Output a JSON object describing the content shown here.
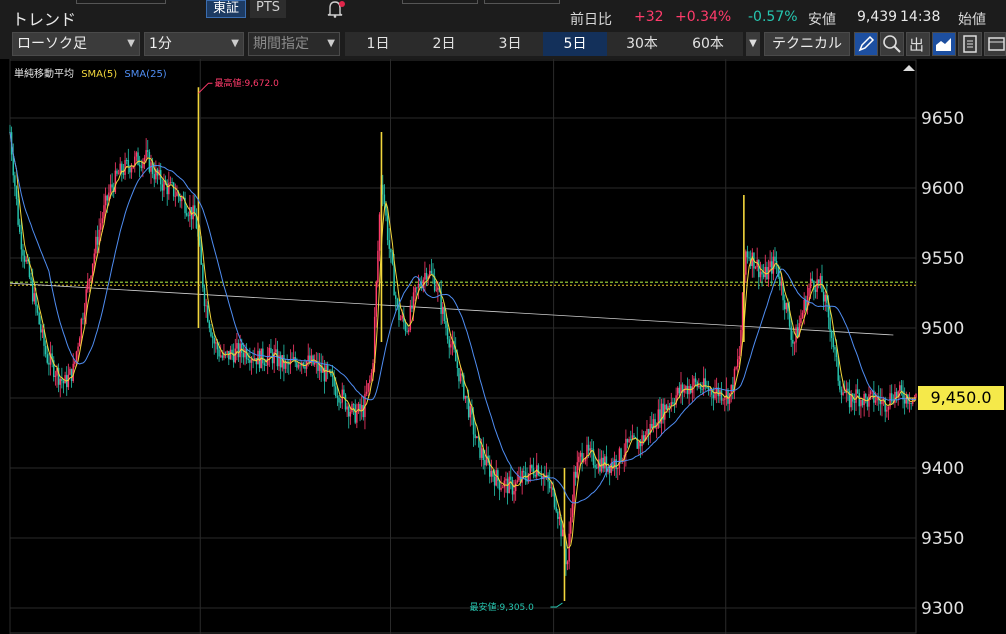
{
  "header": {
    "title": "トレンド",
    "exchange_tabs": [
      {
        "label": "東証",
        "active": true
      },
      {
        "label": "PTS",
        "active": false
      }
    ],
    "bell_icon": "bell-icon",
    "stats": {
      "prev_label": "前日比",
      "change": "+32",
      "change_pct": "+0.34%",
      "low_pct": "-0.57%",
      "low_label": "安値",
      "low_value": "9,439",
      "time": "14:38",
      "open_label": "始値"
    },
    "colors": {
      "up": "#ff3b6b",
      "down": "#26c6b0",
      "accent": "#1d4fa0"
    }
  },
  "toolbar": {
    "chart_type": "ローソク足",
    "interval": "1分",
    "period_label": "期間指定",
    "ranges": [
      {
        "label": "1日",
        "active": false
      },
      {
        "label": "2日",
        "active": false
      },
      {
        "label": "3日",
        "active": false
      },
      {
        "label": "5日",
        "active": true
      },
      {
        "label": "30本",
        "active": false
      },
      {
        "label": "60本",
        "active": false
      }
    ],
    "technical_label": "テクニカル",
    "tool_icons": [
      "pencil-icon",
      "zoom-icon",
      "output-icon",
      "area-chart-icon",
      "note-icon",
      "layout-icon"
    ]
  },
  "chart": {
    "legend": {
      "label": "単純移動平均",
      "sma5": "SMA(5)",
      "sma25": "SMA(25)",
      "sma5_color": "#f2d63c",
      "sma25_color": "#4f8df2"
    },
    "current_price": "9,450.0",
    "high_label": "最高値:9,672.0",
    "low_label": "最安値:9,305.0"
  },
  "chart_data": {
    "type": "candlestick",
    "x_unit": "1-minute bars over 5 trading days",
    "ylim": [
      9290,
      9700
    ],
    "y_ticks": [
      9300,
      9350,
      9400,
      9450,
      9500,
      9550,
      9600,
      9650
    ],
    "current_price": 9450.0,
    "high": 9672.0,
    "low": 9305.0,
    "reference_level": 9532,
    "trendline": {
      "from": [
        0,
        9532
      ],
      "to": [
        0.975,
        9495
      ]
    },
    "day_separators": [
      0.0,
      0.21,
      0.42,
      0.6,
      0.79
    ],
    "price_path": [
      [
        0.0,
        9640
      ],
      [
        0.01,
        9570
      ],
      [
        0.02,
        9540
      ],
      [
        0.03,
        9510
      ],
      [
        0.04,
        9480
      ],
      [
        0.05,
        9470
      ],
      [
        0.06,
        9460
      ],
      [
        0.07,
        9470
      ],
      [
        0.08,
        9510
      ],
      [
        0.09,
        9545
      ],
      [
        0.1,
        9575
      ],
      [
        0.11,
        9598
      ],
      [
        0.12,
        9610
      ],
      [
        0.13,
        9616
      ],
      [
        0.14,
        9620
      ],
      [
        0.15,
        9622
      ],
      [
        0.16,
        9610
      ],
      [
        0.17,
        9602
      ],
      [
        0.18,
        9598
      ],
      [
        0.19,
        9592
      ],
      [
        0.205,
        9578
      ],
      [
        0.215,
        9520
      ],
      [
        0.225,
        9490
      ],
      [
        0.235,
        9478
      ],
      [
        0.245,
        9482
      ],
      [
        0.26,
        9484
      ],
      [
        0.275,
        9478
      ],
      [
        0.29,
        9480
      ],
      [
        0.305,
        9472
      ],
      [
        0.32,
        9478
      ],
      [
        0.335,
        9474
      ],
      [
        0.35,
        9466
      ],
      [
        0.365,
        9452
      ],
      [
        0.38,
        9438
      ],
      [
        0.39,
        9442
      ],
      [
        0.4,
        9470
      ],
      [
        0.41,
        9610
      ],
      [
        0.418,
        9560
      ],
      [
        0.428,
        9510
      ],
      [
        0.438,
        9500
      ],
      [
        0.448,
        9525
      ],
      [
        0.46,
        9542
      ],
      [
        0.47,
        9532
      ],
      [
        0.48,
        9504
      ],
      [
        0.492,
        9476
      ],
      [
        0.505,
        9446
      ],
      [
        0.515,
        9418
      ],
      [
        0.528,
        9400
      ],
      [
        0.54,
        9390
      ],
      [
        0.555,
        9386
      ],
      [
        0.57,
        9395
      ],
      [
        0.582,
        9402
      ],
      [
        0.595,
        9387
      ],
      [
        0.603,
        9375
      ],
      [
        0.61,
        9350
      ],
      [
        0.615,
        9330
      ],
      [
        0.622,
        9392
      ],
      [
        0.632,
        9412
      ],
      [
        0.645,
        9406
      ],
      [
        0.658,
        9402
      ],
      [
        0.67,
        9405
      ],
      [
        0.682,
        9416
      ],
      [
        0.695,
        9418
      ],
      [
        0.71,
        9432
      ],
      [
        0.725,
        9445
      ],
      [
        0.74,
        9455
      ],
      [
        0.755,
        9460
      ],
      [
        0.77,
        9456
      ],
      [
        0.785,
        9454
      ],
      [
        0.795,
        9452
      ],
      [
        0.805,
        9480
      ],
      [
        0.812,
        9555
      ],
      [
        0.822,
        9548
      ],
      [
        0.832,
        9536
      ],
      [
        0.845,
        9548
      ],
      [
        0.855,
        9520
      ],
      [
        0.865,
        9488
      ],
      [
        0.875,
        9512
      ],
      [
        0.885,
        9534
      ],
      [
        0.895,
        9530
      ],
      [
        0.905,
        9504
      ],
      [
        0.915,
        9462
      ],
      [
        0.925,
        9448
      ],
      [
        0.935,
        9452
      ],
      [
        0.945,
        9448
      ],
      [
        0.955,
        9450
      ],
      [
        0.965,
        9446
      ],
      [
        0.975,
        9453
      ],
      [
        0.985,
        9452
      ],
      [
        1.0,
        9450
      ]
    ],
    "spikes": [
      {
        "x": 0.208,
        "high": 9672,
        "low": 9500
      },
      {
        "x": 0.41,
        "high": 9640,
        "low": 9490
      },
      {
        "x": 0.612,
        "high": 9400,
        "low": 9305
      },
      {
        "x": 0.81,
        "high": 9595,
        "low": 9490
      }
    ]
  }
}
